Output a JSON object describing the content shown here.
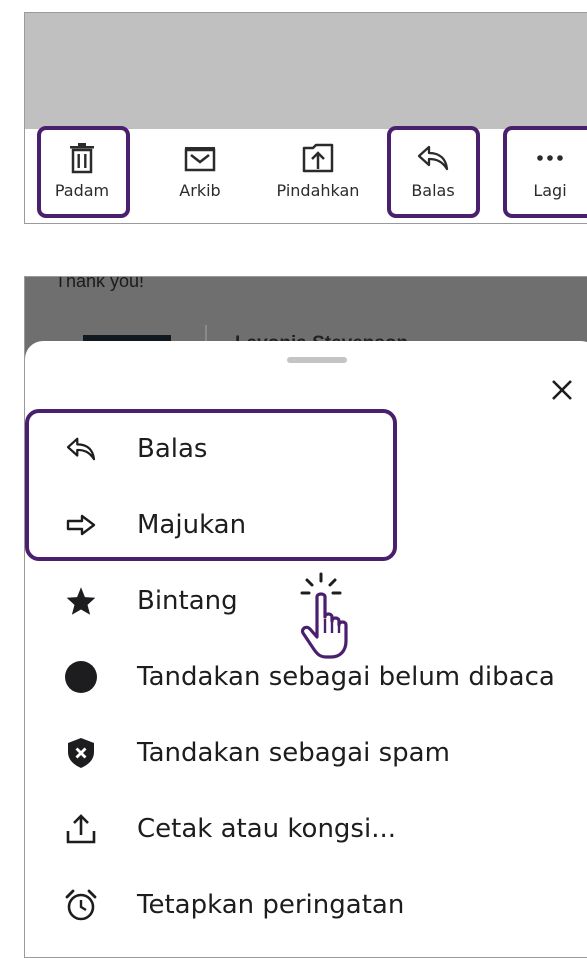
{
  "toolbar": {
    "items": [
      {
        "label": "Padam",
        "icon": "trash-icon",
        "highlighted": true
      },
      {
        "label": "Arkib",
        "icon": "archive-icon",
        "highlighted": false
      },
      {
        "label": "Pindahkan",
        "icon": "move-icon",
        "highlighted": false
      },
      {
        "label": "Balas",
        "icon": "reply-icon",
        "highlighted": true
      },
      {
        "label": "Lagi",
        "icon": "more-icon",
        "highlighted": true
      }
    ]
  },
  "background": {
    "text": "Thank you!",
    "sender_name": "Lavonia Stevenson"
  },
  "sheet": {
    "close_icon": "close-icon",
    "items": [
      {
        "label": "Balas",
        "icon": "reply-icon",
        "highlighted": true
      },
      {
        "label": "Majukan",
        "icon": "forward-icon",
        "highlighted": true
      },
      {
        "label": "Bintang",
        "icon": "star-icon",
        "highlighted": false
      },
      {
        "label": "Tandakan sebagai belum dibaca",
        "icon": "unread-dot-icon",
        "highlighted": false
      },
      {
        "label": "Tandakan sebagai spam",
        "icon": "spam-shield-icon",
        "highlighted": false
      },
      {
        "label": "Cetak atau kongsi...",
        "icon": "share-upload-icon",
        "highlighted": false
      },
      {
        "label": "Tetapkan peringatan",
        "icon": "alarm-clock-icon",
        "highlighted": false
      }
    ]
  },
  "colors": {
    "highlight_border": "#4a1f6e",
    "icon_color": "#2b2b2b",
    "text_color": "#1d1d1f",
    "overlay": "#6f6f6f"
  }
}
